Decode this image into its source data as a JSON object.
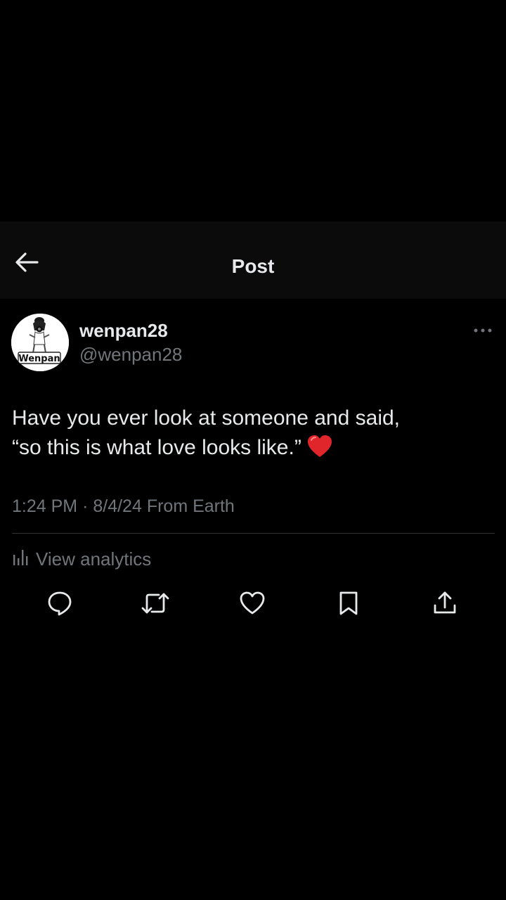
{
  "header": {
    "title": "Post",
    "back_icon": "arrow-left-icon"
  },
  "author": {
    "display_name": "wenpan28",
    "handle": "@wenpan28",
    "avatar_text": "Wenpan"
  },
  "post": {
    "text_line1": "Have you ever look at someone and said,",
    "text_line2": "“so this is what love looks like.”",
    "emoji": "red-heart",
    "time": "1:24 PM",
    "separator": "·",
    "date": "8/4/24",
    "source": "From Earth"
  },
  "analytics": {
    "label": "View analytics",
    "icon": "bar-chart-icon"
  },
  "actions": [
    {
      "name": "reply",
      "icon": "reply-icon"
    },
    {
      "name": "repost",
      "icon": "repost-icon"
    },
    {
      "name": "like",
      "icon": "heart-icon"
    },
    {
      "name": "bookmark",
      "icon": "bookmark-icon"
    },
    {
      "name": "share",
      "icon": "share-icon"
    }
  ],
  "colors": {
    "background": "#000000",
    "header_bg": "#0b0b0c",
    "primary_text": "#e7e9ea",
    "secondary_text": "#71767b",
    "divider": "#2f3336",
    "heart": "#e0262b"
  }
}
